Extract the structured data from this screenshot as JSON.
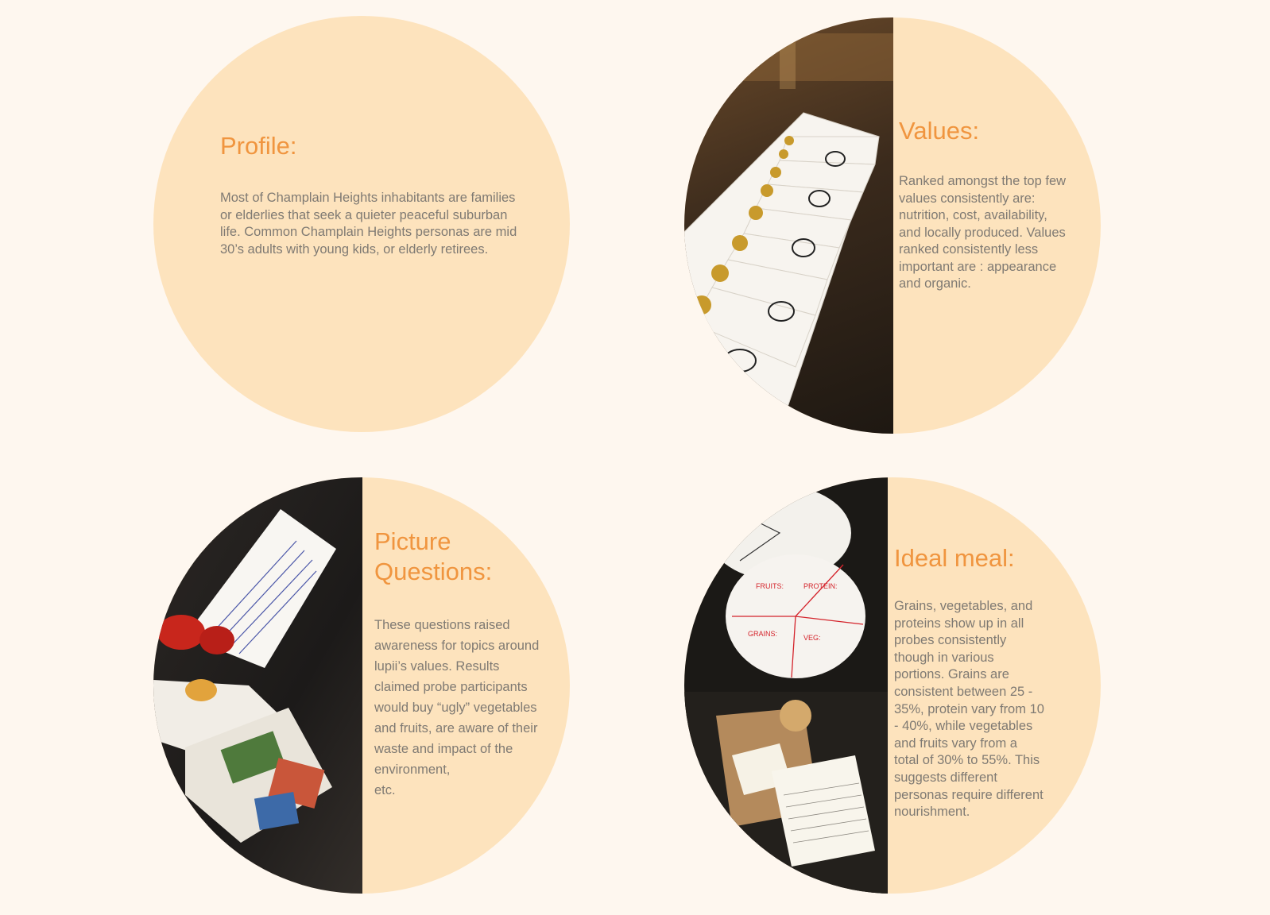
{
  "profile": {
    "title": "Profile:",
    "body": "Most of Champlain Heights inhabitants are families or elderlies that seek a quieter peaceful suburban life. Common Champlain Heights personas are mid 30’s adults with young kids, or elderly retirees."
  },
  "values": {
    "title": "Values:",
    "body": "Ranked amongst the top few values consistently are: nutrition, cost, availability, and locally produced. Values ranked consistently less important are : appearance and organic.",
    "photo_icon": "value-ranking-cards-photo"
  },
  "picture_questions": {
    "title_line1": "Picture",
    "title_line2": "Questions:",
    "body": "These questions raised awareness for topics around lupii’s values. Results claimed probe participants would buy “ugly” vegetables and fruits, are aware of their waste and impact of the environment,\n etc.",
    "photo_icon": "picture-question-cards-photo"
  },
  "ideal_meal": {
    "title": "Ideal meal:",
    "body": "Grains, vegetables, and proteins show up in all probes consistently though in various portions. Grains are consistent between 25 - 35%, protein vary from 10 - 40%, while vegetables and fruits vary from a total of 30% to 55%. This suggests different personas require different nourishment.",
    "photo_icon": "meal-plate-and-recipe-journal-photo"
  },
  "colors": {
    "page_background": "#fef7ef",
    "circle_fill": "#fde3bd",
    "heading": "#f0953f",
    "body_text": "#7f7a73"
  }
}
